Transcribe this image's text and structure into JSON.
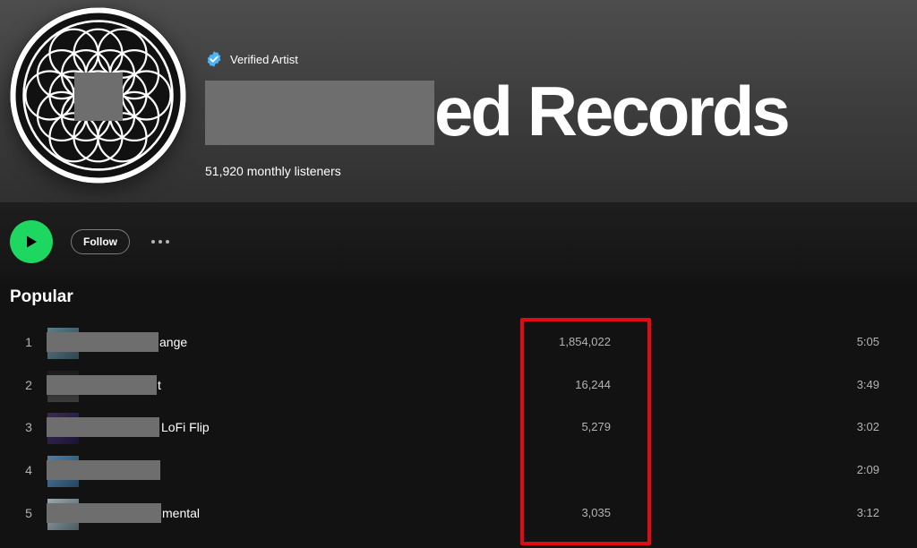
{
  "header": {
    "verified_label": "Verified Artist",
    "artist_name_visible": "ed Records",
    "monthly_listeners": "51,920 monthly listeners"
  },
  "actions": {
    "follow_label": "Follow"
  },
  "popular": {
    "title": "Popular",
    "tracks": [
      {
        "num": "1",
        "title_visible": "ange",
        "plays": "1,854,022",
        "duration": "5:05"
      },
      {
        "num": "2",
        "title_visible": "t",
        "plays": "16,244",
        "duration": "3:49"
      },
      {
        "num": "3",
        "title_visible": "LoFi Flip",
        "plays": "5,279",
        "duration": "3:02"
      },
      {
        "num": "4",
        "title_visible": "",
        "plays": "",
        "duration": "2:09"
      },
      {
        "num": "5",
        "title_visible": "mental",
        "plays": "3,035",
        "duration": "3:12"
      }
    ]
  },
  "colors": {
    "accent_green": "#1ed760",
    "highlight_red": "#e10a12",
    "verified_blue": "#4cb3ff",
    "redaction_gray": "#6e6e6e"
  },
  "icons": {
    "verified": "verified-badge-icon",
    "play": "play-icon",
    "more": "more-horizontal-icon"
  }
}
